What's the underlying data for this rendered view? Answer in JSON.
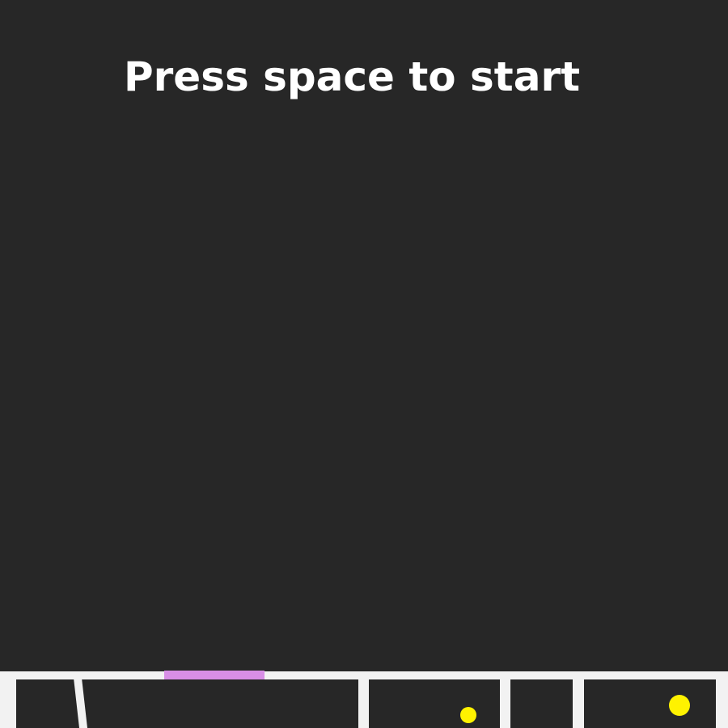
{
  "game": {
    "start_prompt": "Press space to start"
  },
  "colors": {
    "background": "#272727",
    "wall": "#f2f2f2",
    "player": "#d88ee6",
    "coin": "#fff200",
    "prompt_text": "#ffffff"
  },
  "entities": {
    "player": "player-platform",
    "coins": [
      "coin",
      "coin"
    ]
  }
}
